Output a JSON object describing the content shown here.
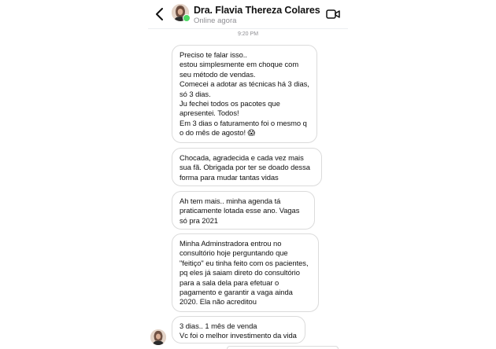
{
  "header": {
    "contact_name": "Dra. Flavia Thereza Colares",
    "status": "Online agora",
    "back_icon": "chevron-left-icon",
    "video_icon": "video-camera-icon"
  },
  "timestamp": "9:20 PM",
  "messages": [
    {
      "text": "Preciso te falar isso..\nestou simplesmente em choque com seu método de vendas.\n Comecei a adotar as técnicas há  3 dias, só 3 dias.\nJu fechei todos os pacotes que apresentei. Todos!\nEm 3 dias o faturamento foi o mesmo q o do mês de agosto! 😱"
    },
    {
      "text": "Chocada, agradecida e cada vez mais sua fã. Obrigada por ter se doado dessa forma para mudar tantas vidas"
    },
    {
      "text": "Ah tem mais.. minha agenda tá praticamente lotada esse ano. Vagas só pra 2021"
    },
    {
      "text": "Minha Adminstradora entrou no consultório hoje perguntando que \"feitiço\" eu tinha feito com os pacientes, pq eles já saiam direto do consultório para a sala dela para efetuar o pagamento e garantir a vaga ainda 2020. Ela não acreditou"
    },
    {
      "text": "3 dias.. 1 mês de venda\nVc foi o melhor investimento da vida"
    }
  ],
  "colors": {
    "online": "#4cd964",
    "bubble_border": "#dbdbdb",
    "muted_text": "#8e8e93"
  }
}
